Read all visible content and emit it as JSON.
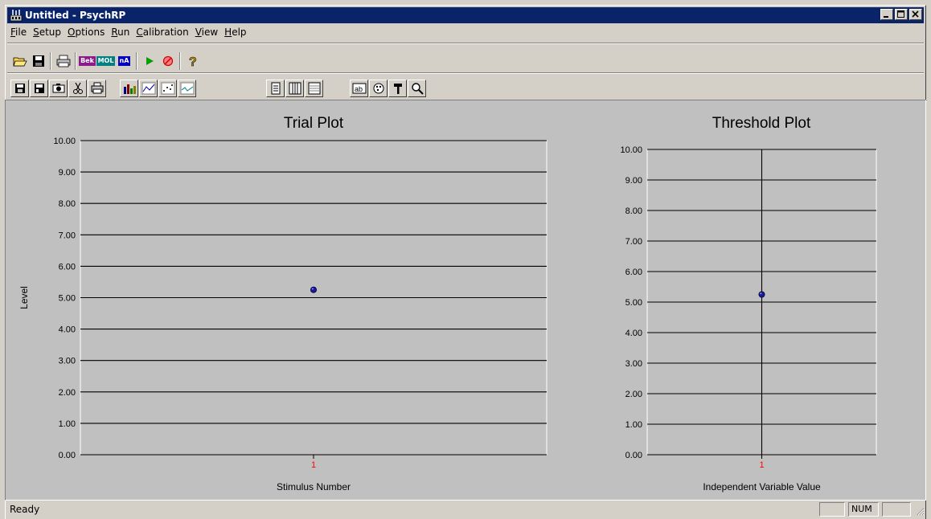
{
  "window": {
    "title": "Untitled - PsychRP"
  },
  "menu": [
    {
      "label": "File",
      "underline": "F",
      "rest": "ile"
    },
    {
      "label": "Setup",
      "underline": "S",
      "rest": "etup"
    },
    {
      "label": "Options",
      "underline": "O",
      "rest": "ptions"
    },
    {
      "label": "Run",
      "underline": "R",
      "rest": "un"
    },
    {
      "label": "Calibration",
      "underline": "C",
      "rest": "alibration"
    },
    {
      "label": "View",
      "underline": "V",
      "rest": "iew"
    },
    {
      "label": "Help",
      "underline": "H",
      "rest": "elp"
    }
  ],
  "toolbar": {
    "bek": "Bek",
    "mol": "MOL",
    "na": "nA"
  },
  "colors": {
    "titlebar": "#0a246a",
    "bek": "#8b1a8b",
    "mol": "#008080",
    "na": "#0000c0",
    "point": "#1a1aa0",
    "tick_label": "#ff0000"
  },
  "chart_data": [
    {
      "type": "scatter",
      "title": "Trial Plot",
      "xlabel": "Stimulus Number",
      "ylabel": "Level",
      "ylim": [
        0,
        10
      ],
      "yticks": [
        "0.00",
        "1.00",
        "2.00",
        "3.00",
        "4.00",
        "5.00",
        "6.00",
        "7.00",
        "8.00",
        "9.00",
        "10.00"
      ],
      "categories": [
        "1"
      ],
      "series": [
        {
          "values": [
            5.25
          ]
        }
      ],
      "grid": true
    },
    {
      "type": "scatter",
      "title": "Threshold Plot",
      "xlabel": "Independent Variable Value",
      "ylabel": "",
      "ylim": [
        0,
        10
      ],
      "yticks": [
        "0.00",
        "1.00",
        "2.00",
        "3.00",
        "4.00",
        "5.00",
        "6.00",
        "7.00",
        "8.00",
        "9.00",
        "10.00"
      ],
      "categories": [
        "1"
      ],
      "series": [
        {
          "values": [
            5.25
          ]
        }
      ],
      "grid": true
    }
  ],
  "status": {
    "text": "Ready",
    "num": "NUM"
  }
}
